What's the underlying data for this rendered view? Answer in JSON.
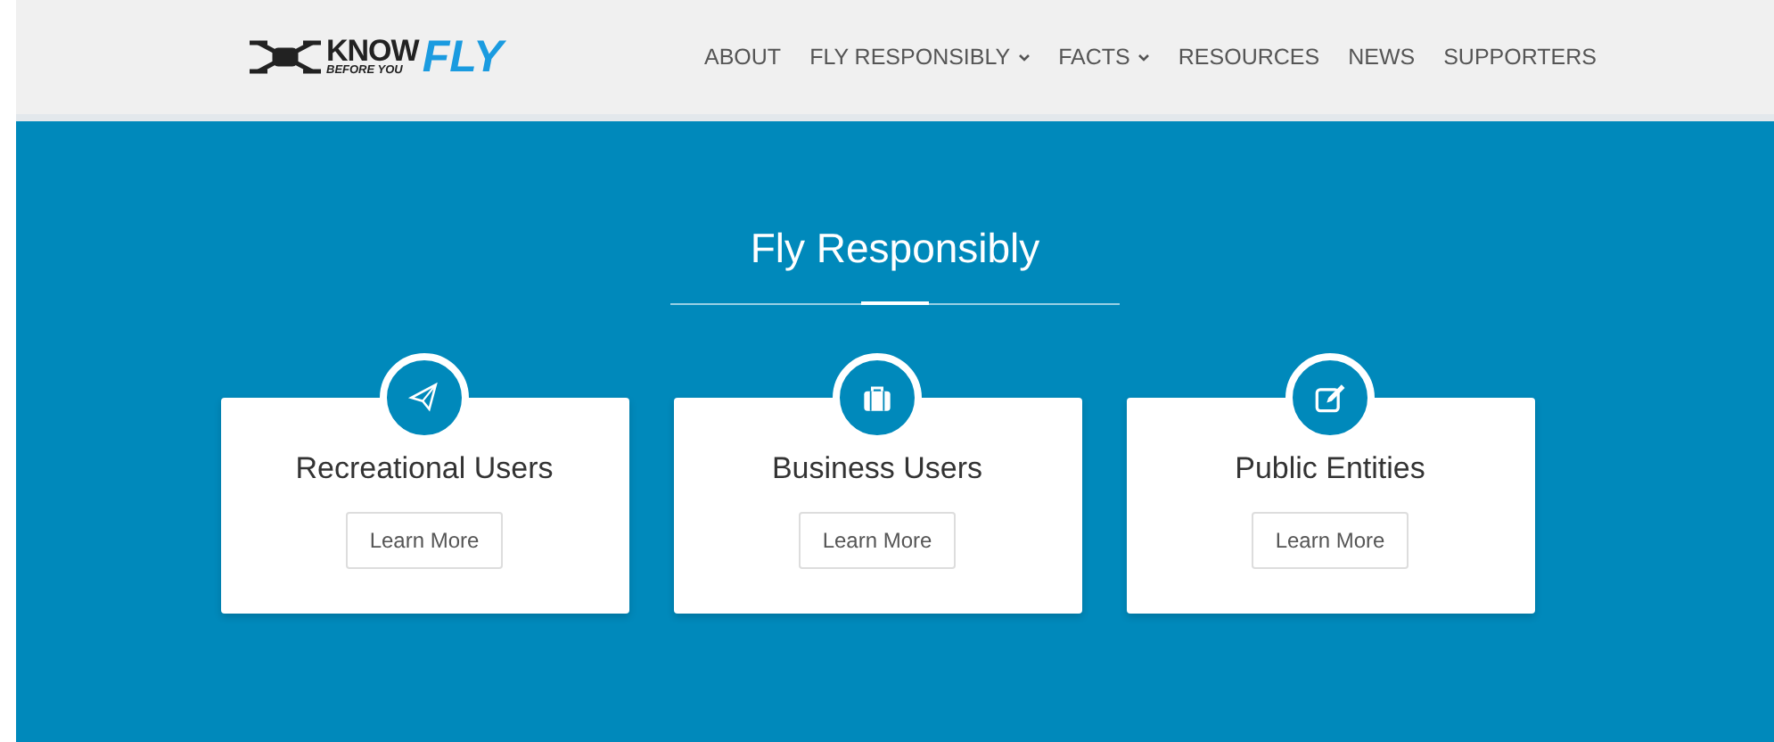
{
  "logo": {
    "word_1": "KNOW",
    "word_2": "BEFORE YOU",
    "word_3": "FLY"
  },
  "nav": [
    {
      "label": "ABOUT",
      "dropdown": false
    },
    {
      "label": "FLY RESPONSIBLY",
      "dropdown": true
    },
    {
      "label": "FACTS",
      "dropdown": true
    },
    {
      "label": "RESOURCES",
      "dropdown": false
    },
    {
      "label": "NEWS",
      "dropdown": false
    },
    {
      "label": "SUPPORTERS",
      "dropdown": false
    }
  ],
  "section": {
    "title": "Fly Responsibly"
  },
  "cards": [
    {
      "kind": "plane",
      "title": "Recreational Users",
      "button": "Learn More"
    },
    {
      "kind": "briefcase",
      "title": "Business Users",
      "button": "Learn More"
    },
    {
      "kind": "edit",
      "title": "Public Entities",
      "button": "Learn More"
    }
  ]
}
